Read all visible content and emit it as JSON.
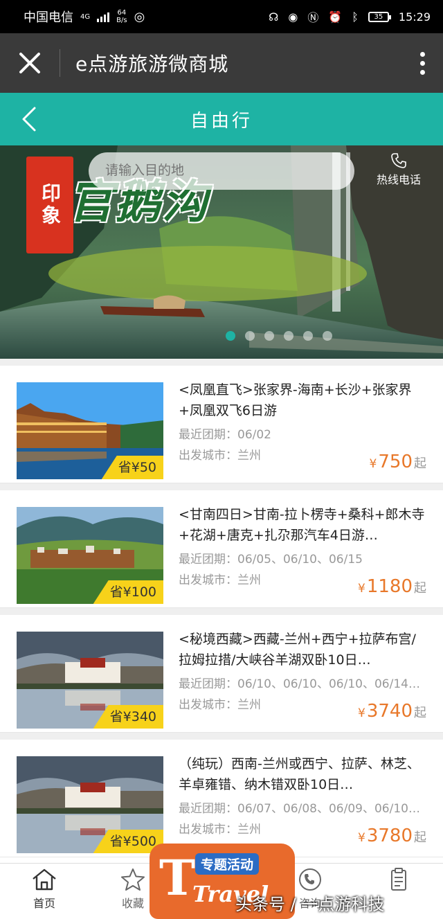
{
  "status_bar": {
    "carrier": "中国电信",
    "network": "4G",
    "speed_value": "64",
    "speed_unit": "B/s",
    "battery": "35",
    "time": "15:29"
  },
  "app_bar": {
    "title": "e点游旅游微商城"
  },
  "header": {
    "title": "自由行"
  },
  "banner": {
    "search_placeholder": "请输入目的地",
    "hotline_label": "热线电话",
    "brand_seal": "印象",
    "brand_title": "官鹅沟"
  },
  "products": [
    {
      "name": "<凤凰直飞>张家界-海南+长沙+张家界+凤凰双飞6日游",
      "dates_label": "最近团期：",
      "dates": "06/02",
      "city_label": "出发城市：",
      "city": "兰州",
      "save": "省¥50",
      "currency": "¥",
      "price": "750",
      "price_suffix": "起"
    },
    {
      "name": "<甘南四日>甘南-拉卜楞寺+桑科+郎木寺+花湖+唐克+扎尕那汽车4日游…",
      "dates_label": "最近团期：",
      "dates": "06/05、06/10、06/15",
      "city_label": "出发城市：",
      "city": "兰州",
      "save": "省¥100",
      "currency": "¥",
      "price": "1180",
      "price_suffix": "起"
    },
    {
      "name": "<秘境西藏>西藏-兰州+西宁+拉萨布宫/拉姆拉措/大峡谷羊湖双卧10日…",
      "dates_label": "最近团期：",
      "dates": "06/10、06/10、06/10、06/14…",
      "city_label": "出发城市：",
      "city": "兰州",
      "save": "省¥340",
      "currency": "¥",
      "price": "3740",
      "price_suffix": "起"
    },
    {
      "name": "（纯玩）西南-兰州或西宁、拉萨、林芝、羊卓雍错、纳木错双卧10日…",
      "dates_label": "最近团期：",
      "dates": "06/07、06/08、06/09、06/10…",
      "city_label": "出发城市：",
      "city": "兰州",
      "save": "省¥500",
      "currency": "¥",
      "price": "3780",
      "price_suffix": "起"
    }
  ],
  "tabbar": {
    "home": "首页",
    "favorites": "收藏",
    "consult": "咨询",
    "promo_label": "专题活动",
    "promo_word": "Travel"
  },
  "watermark": "头条号 / 一点游科技",
  "colors": {
    "accent": "#1eb3a4",
    "price": "#e8782a",
    "save_badge": "#f7d21a",
    "app_bar": "#3a3a3a"
  }
}
